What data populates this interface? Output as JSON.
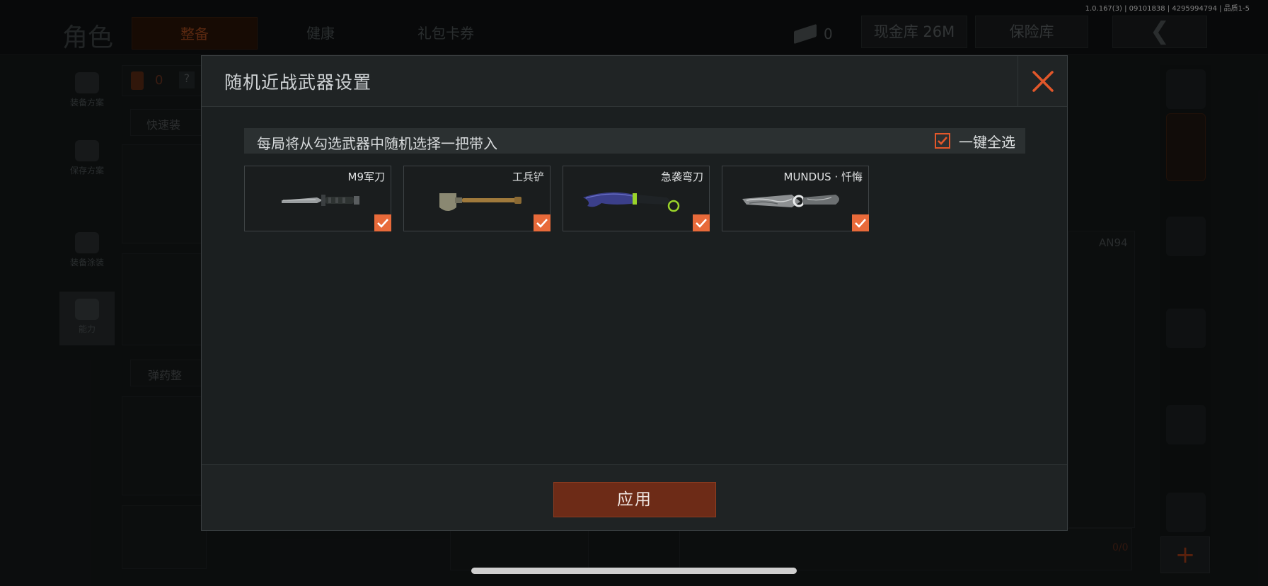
{
  "version_text": "1.0.167(3) | 09101838 | 4295994794 | 品质1-5",
  "header": {
    "title": "角色",
    "tabs": [
      {
        "label": "整备",
        "active": true
      },
      {
        "label": "健康",
        "active": false
      },
      {
        "label": "礼包卡券",
        "active": false
      }
    ],
    "currency_value": "0",
    "cash_storage_label": "现金库 26M",
    "safe_label": "保险库",
    "back_icon": "chevron-left-icon"
  },
  "left_nav": [
    {
      "label": "装备方案",
      "icon": "vest-icon"
    },
    {
      "label": "保存方案",
      "icon": "download-icon"
    },
    {
      "label": "装备涂装",
      "icon": "helmet-icon"
    },
    {
      "label": "能力",
      "icon": "ability-icon",
      "selected": true
    }
  ],
  "background_labels": {
    "armor_count": "0",
    "help_mark": "?",
    "quick_equip": "快速装",
    "ammo_adjust": "弹药整",
    "weapon_name": "AN94",
    "ammo_count": "0/0",
    "add_symbol": "+"
  },
  "modal": {
    "title": "随机近战武器设置",
    "close_icon": "close-icon",
    "info_text": "每局将从勾选武器中随机选择一把带入",
    "select_all_label": "一键全选",
    "select_all_checked": true,
    "weapons": [
      {
        "name": "M9军刀",
        "image": "m9-bayonet-image",
        "checked": true
      },
      {
        "name": "工兵铲",
        "image": "entrenching-shovel-image",
        "checked": true
      },
      {
        "name": "急袭弯刀",
        "image": "karambit-image",
        "checked": true
      },
      {
        "name": "MUNDUS · 忏悔",
        "image": "damascus-knife-image",
        "checked": true
      }
    ],
    "apply_label": "应用"
  },
  "colors": {
    "accent": "#e86a3a",
    "apply_button": "#6d2b17",
    "modal_bg": "#1b1f20"
  }
}
